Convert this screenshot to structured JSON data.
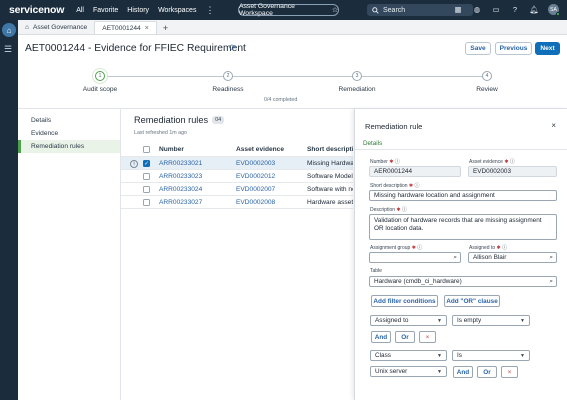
{
  "topbar": {
    "logo_text": "servicenow",
    "nav": [
      "All",
      "Favorite",
      "History",
      "Workspaces"
    ],
    "more": "⋮",
    "workspace_label": "Asset Governance Workspace",
    "search_placeholder": "Search",
    "avatar_initials": "SA"
  },
  "tabs": [
    {
      "label": "Asset Governance"
    },
    {
      "label": "AET0001244"
    }
  ],
  "header": {
    "title": "AET0001244 - Evidence for FFIEC Requirement",
    "save": "Save",
    "previous": "Previous",
    "next": "Next"
  },
  "stepper": {
    "steps": [
      {
        "num": "1",
        "label": "Audit scope"
      },
      {
        "num": "2",
        "label": "Readiness"
      },
      {
        "num": "3",
        "label": "Remediation"
      },
      {
        "num": "4",
        "label": "Review"
      }
    ],
    "completed_text": "0/4 completed"
  },
  "leftnav": [
    "Details",
    "Evidence",
    "Remediation rules"
  ],
  "main": {
    "title": "Remediation rules",
    "count": "04",
    "refreshed": "Last refreshed 1m ago",
    "columns": [
      "Number",
      "Asset evidence",
      "Short description"
    ],
    "rows": [
      {
        "number": "ARR00233021",
        "evidence": "EVD0002003",
        "desc": "Missing Hardware...",
        "selected": true
      },
      {
        "number": "ARR00233023",
        "evidence": "EVD0002012",
        "desc": "Software Models w...",
        "selected": false
      },
      {
        "number": "ARR00233024",
        "evidence": "EVD0002007",
        "desc": "Software with no...",
        "selected": false
      },
      {
        "number": "ARR00233027",
        "evidence": "EVD0002008",
        "desc": "Hardware assets w...",
        "selected": false
      }
    ]
  },
  "panel": {
    "title": "Remediation rule",
    "tab": "Details",
    "number_label": "Number",
    "number_value": "AER0001244",
    "asset_evidence_label": "Asset evidence",
    "asset_evidence_value": "EVD0002003",
    "short_desc_label": "Short description",
    "short_desc_value": "Missing hardware location and assignment",
    "description_label": "Description",
    "description_value": "Validation of hardware records that are missing assignment OR location data.",
    "assignment_group_label": "Assignment group",
    "assignment_group_value": "",
    "assigned_to_label": "Assigned to",
    "assigned_to_value": "Allison Blair",
    "table_label": "Table",
    "table_value": "Hardware (cmdb_ci_hardware)",
    "add_filter": "Add filter conditions",
    "add_or": "Add \"OR\" clause",
    "cond1_field": "Assigned to",
    "cond1_op": "Is empty",
    "and": "And",
    "or": "Or",
    "remove": "×",
    "cond2_field": "Class",
    "cond2_op": "Is",
    "cond2_value": "Unix server"
  }
}
